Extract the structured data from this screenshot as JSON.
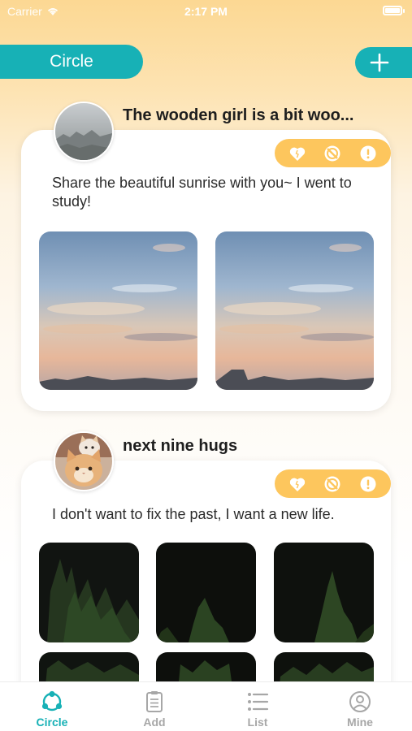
{
  "status_bar": {
    "carrier": "Carrier",
    "time": "2:17 PM"
  },
  "header": {
    "circle_button": "Circle",
    "add_icon": "plus-icon"
  },
  "posts": [
    {
      "author": "The wooden girl is a bit woo...",
      "avatar": "foggy-landscape-avatar",
      "text": "Share the beautiful sunrise with you~ I went to study!",
      "actions": [
        "heart-icon",
        "block-icon",
        "report-icon"
      ],
      "images": [
        "sunrise-sky-photo",
        "sunrise-sky-photo"
      ]
    },
    {
      "author": "next nine hugs",
      "avatar": "cats-avatar",
      "text": "I don't want to fix the past, I want a new life.",
      "actions": [
        "heart-icon",
        "block-icon",
        "report-icon"
      ],
      "images": [
        "night-tree-photo",
        "night-tree-photo",
        "night-tree-photo",
        "night-tree-photo",
        "night-tree-photo",
        "night-tree-photo"
      ]
    }
  ],
  "tabbar": {
    "active": "Circle",
    "items": [
      {
        "label": "Circle",
        "icon": "circle-network-icon"
      },
      {
        "label": "Add",
        "icon": "clipboard-icon"
      },
      {
        "label": "List",
        "icon": "list-icon"
      },
      {
        "label": "Mine",
        "icon": "user-icon"
      }
    ]
  },
  "colors": {
    "accent": "#17b1b6",
    "action_pill": "#fdc65d",
    "tab_inactive": "#a7a7a7"
  }
}
